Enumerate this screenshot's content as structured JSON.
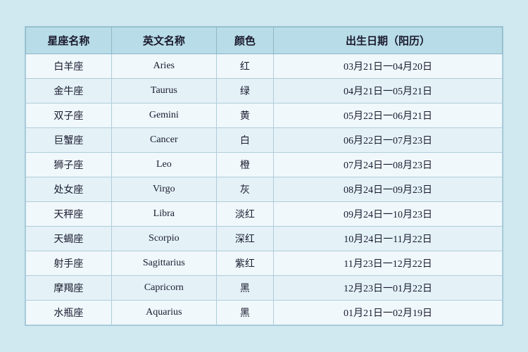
{
  "table": {
    "headers": [
      "星座名称",
      "英文名称",
      "颜色",
      "出生日期（阳历）"
    ],
    "rows": [
      {
        "chinese": "白羊座",
        "english": "Aries",
        "color": "红",
        "date": "03月21日一04月20日"
      },
      {
        "chinese": "金牛座",
        "english": "Taurus",
        "color": "绿",
        "date": "04月21日一05月21日"
      },
      {
        "chinese": "双子座",
        "english": "Gemini",
        "color": "黄",
        "date": "05月22日一06月21日"
      },
      {
        "chinese": "巨蟹座",
        "english": "Cancer",
        "color": "白",
        "date": "06月22日一07月23日"
      },
      {
        "chinese": "狮子座",
        "english": "Leo",
        "color": "橙",
        "date": "07月24日一08月23日"
      },
      {
        "chinese": "处女座",
        "english": "Virgo",
        "color": "灰",
        "date": "08月24日一09月23日"
      },
      {
        "chinese": "天秤座",
        "english": "Libra",
        "color": "淡红",
        "date": "09月24日一10月23日"
      },
      {
        "chinese": "天蝎座",
        "english": "Scorpio",
        "color": "深红",
        "date": "10月24日一11月22日"
      },
      {
        "chinese": "射手座",
        "english": "Sagittarius",
        "color": "紫红",
        "date": "11月23日一12月22日"
      },
      {
        "chinese": "摩羯座",
        "english": "Capricorn",
        "color": "黑",
        "date": "12月23日一01月22日"
      },
      {
        "chinese": "水瓶座",
        "english": "Aquarius",
        "color": "黑",
        "date": "01月21日一02月19日"
      }
    ]
  }
}
